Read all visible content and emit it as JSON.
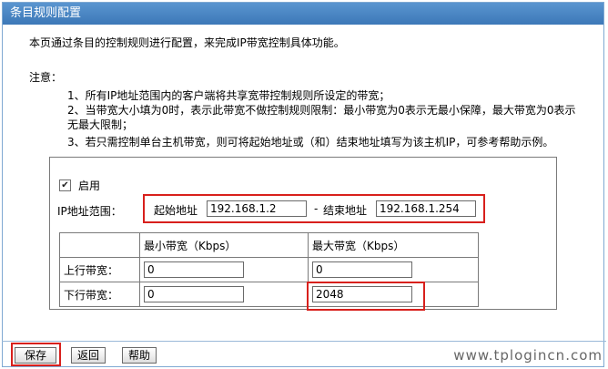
{
  "window": {
    "title": "条目规则配置"
  },
  "intro": "本页通过条目的控制规则进行配置，来完成IP带宽控制具体功能。",
  "notes": {
    "title": "注意：",
    "lines": [
      "1、所有IP地址范围内的客户端将共享宽带控制规则所设定的带宽；",
      "2、当带宽大小填为0时，表示此带宽不做控制规则限制：最小带宽为0表示无最小保障，最大带宽为0表示",
      "无最大限制；",
      "3、若只需控制单台主机带宽，则可将起始地址或（和）结束地址填写为该主机IP，可参考帮助示例。"
    ]
  },
  "form": {
    "enable_label": "启用",
    "enable_checked": "✔",
    "ip_range_label": "IP地址范围：",
    "start_label": "起始地址",
    "start_value": "192.168.1.2",
    "separator": "-",
    "end_label": "结束地址",
    "end_value": "192.168.1.254"
  },
  "bandwidth_table": {
    "headers": [
      "",
      "最小带宽（Kbps）",
      "最大带宽（Kbps）"
    ],
    "rows": [
      {
        "label": "上行带宽：",
        "min": "0",
        "max": "0"
      },
      {
        "label": "下行带宽：",
        "min": "0",
        "max": "2048"
      }
    ]
  },
  "buttons": {
    "save": "保存",
    "back": "返回",
    "help": "帮助"
  },
  "watermark": "www.tplogincn.com",
  "colors": {
    "title_bar": "#4a86c4",
    "highlight": "#d8201c"
  }
}
